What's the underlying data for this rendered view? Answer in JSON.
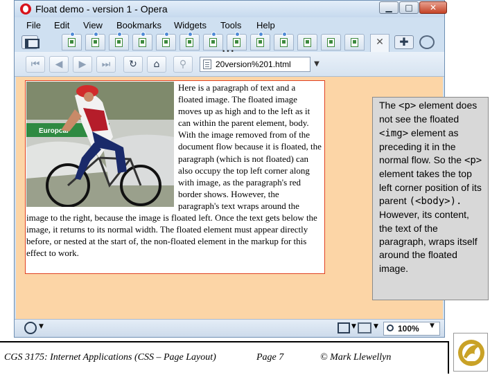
{
  "window": {
    "title": "Float demo - version 1 - Opera",
    "caption_buttons": {
      "minimize": "▁",
      "maximize": "□",
      "close": "✕"
    }
  },
  "menu": [
    "File",
    "Edit",
    "View",
    "Bookmarks",
    "Widgets",
    "Tools",
    "Help"
  ],
  "tabs": {
    "count": 13,
    "active_close": "✕",
    "new_tab": "✚",
    "grip": "•••"
  },
  "nav": {
    "back_to_start": "⏮",
    "back": "◀",
    "forward": "▶",
    "fast_forward": "⏭",
    "reload": "↻",
    "home": "⌂",
    "wand": "⚲"
  },
  "address": {
    "text": "20version%201.html",
    "dropdown": "▼"
  },
  "paragraph": {
    "text": "Here is a paragraph of text and a floated image. The floated image moves up as high and to the left as it can within the parent element, body. With the image removed from of the document flow because it is floated, the paragraph (which is not floated) can also occupy the top left corner along with image, as the paragraph's red border shows. However, the paragraph's text wraps around the image to the right, because the image is floated left. Once the text gets below the image, it returns to its normal width. The floated element must appear directly before, or nested at the start of, the non-floated element in the markup for this effect to work."
  },
  "image": {
    "banner_text": "Europcar"
  },
  "status": {
    "zoom": "100%",
    "dropdown": "▼"
  },
  "callout": {
    "t1": "The ",
    "code1": "<p>",
    "t2": " element does not see the floated ",
    "code2": "<img>",
    "t3": " element as preceding it in the normal flow. So the ",
    "code3": "<p>",
    "t4": " element takes the top left corner position of its parent ",
    "code4": "(<body>).",
    "t5": " However, its content, the text of the paragraph, wraps itself around the floated image."
  },
  "footer": {
    "course": "CGS 3175: Internet Applications (CSS – Page Layout)",
    "page": "Page 7",
    "copyright": "© Mark Llewellyn"
  },
  "colors": {
    "page_background": "#fcd5a6",
    "paragraph_border": "#e04020",
    "callout_background": "#d8d8d8",
    "logo_gold": "#c9a227"
  }
}
